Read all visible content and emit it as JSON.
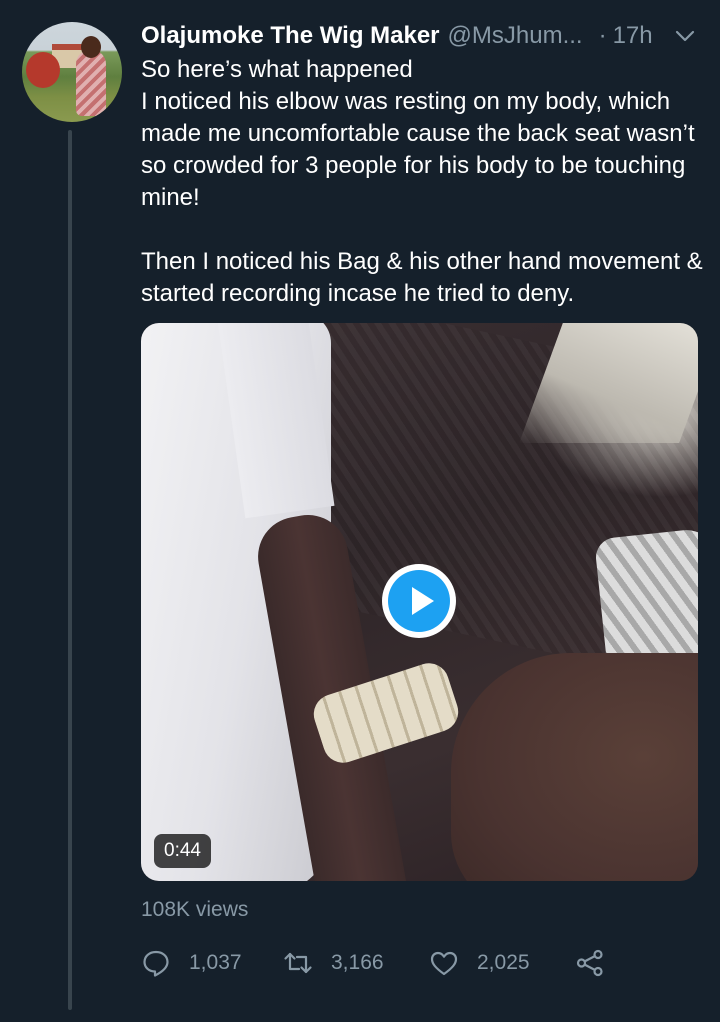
{
  "tweet": {
    "display_name": "Olajumoke The Wig Maker",
    "handle": "@MsJhum...",
    "separator": "·",
    "time": "17h",
    "paragraphs": [
      "So here’s what happened\nI noticed his elbow was resting on my body, which made me uncomfortable cause the back seat wasn’t so crowded for 3 people for his body to be touching mine!",
      "Then I noticed his Bag & his other hand movement & started recording incase he tried to deny."
    ],
    "media": {
      "type": "video",
      "duration": "0:44",
      "views": "108K views"
    },
    "actions": {
      "reply_count": "1,037",
      "retweet_count": "3,166",
      "like_count": "2,025"
    }
  },
  "colors": {
    "background": "#15202b",
    "text_primary": "#ffffff",
    "text_secondary": "#8899a6",
    "accent": "#1da1f2",
    "thread_line": "#38444d"
  },
  "icons": {
    "caret": "chevron-down-icon",
    "play": "play-icon",
    "reply": "comment-icon",
    "retweet": "retweet-icon",
    "like": "heart-icon",
    "share": "share-icon"
  }
}
